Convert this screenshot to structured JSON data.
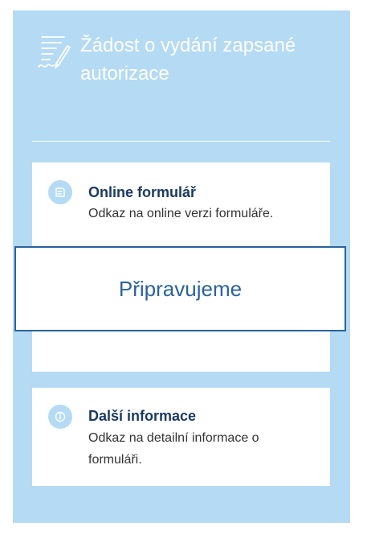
{
  "header": {
    "icon": "form-signature-icon",
    "title": "Žádost o vydání zapsané autorizace"
  },
  "cards": {
    "online": {
      "icon": "online-form-icon",
      "title": "Online formulář",
      "description": "Odkaz na online verzi formuláře."
    },
    "info": {
      "icon": "info-icon",
      "title": "Další informace",
      "description": "Odkaz na detailní informace o formuláři."
    }
  },
  "overlay": {
    "label": "Připravujeme"
  },
  "colors": {
    "panel_background": "#b5daf4",
    "card_background": "#ffffff",
    "title_color": "#1b3a63",
    "overlay_accent": "#2a62a0"
  }
}
